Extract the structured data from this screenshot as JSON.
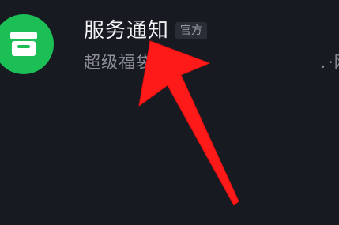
{
  "chat_item": {
    "name": "服务通知",
    "badge": "官方",
    "preview": "超级福袋助手：　　　　　　　．·刚",
    "avatar_icon": "inbox-icon",
    "avatar_color": "#1bbf55"
  },
  "annotation": {
    "arrow_icon": "red-arrow-icon",
    "arrow_color": "#ff1a1a"
  }
}
